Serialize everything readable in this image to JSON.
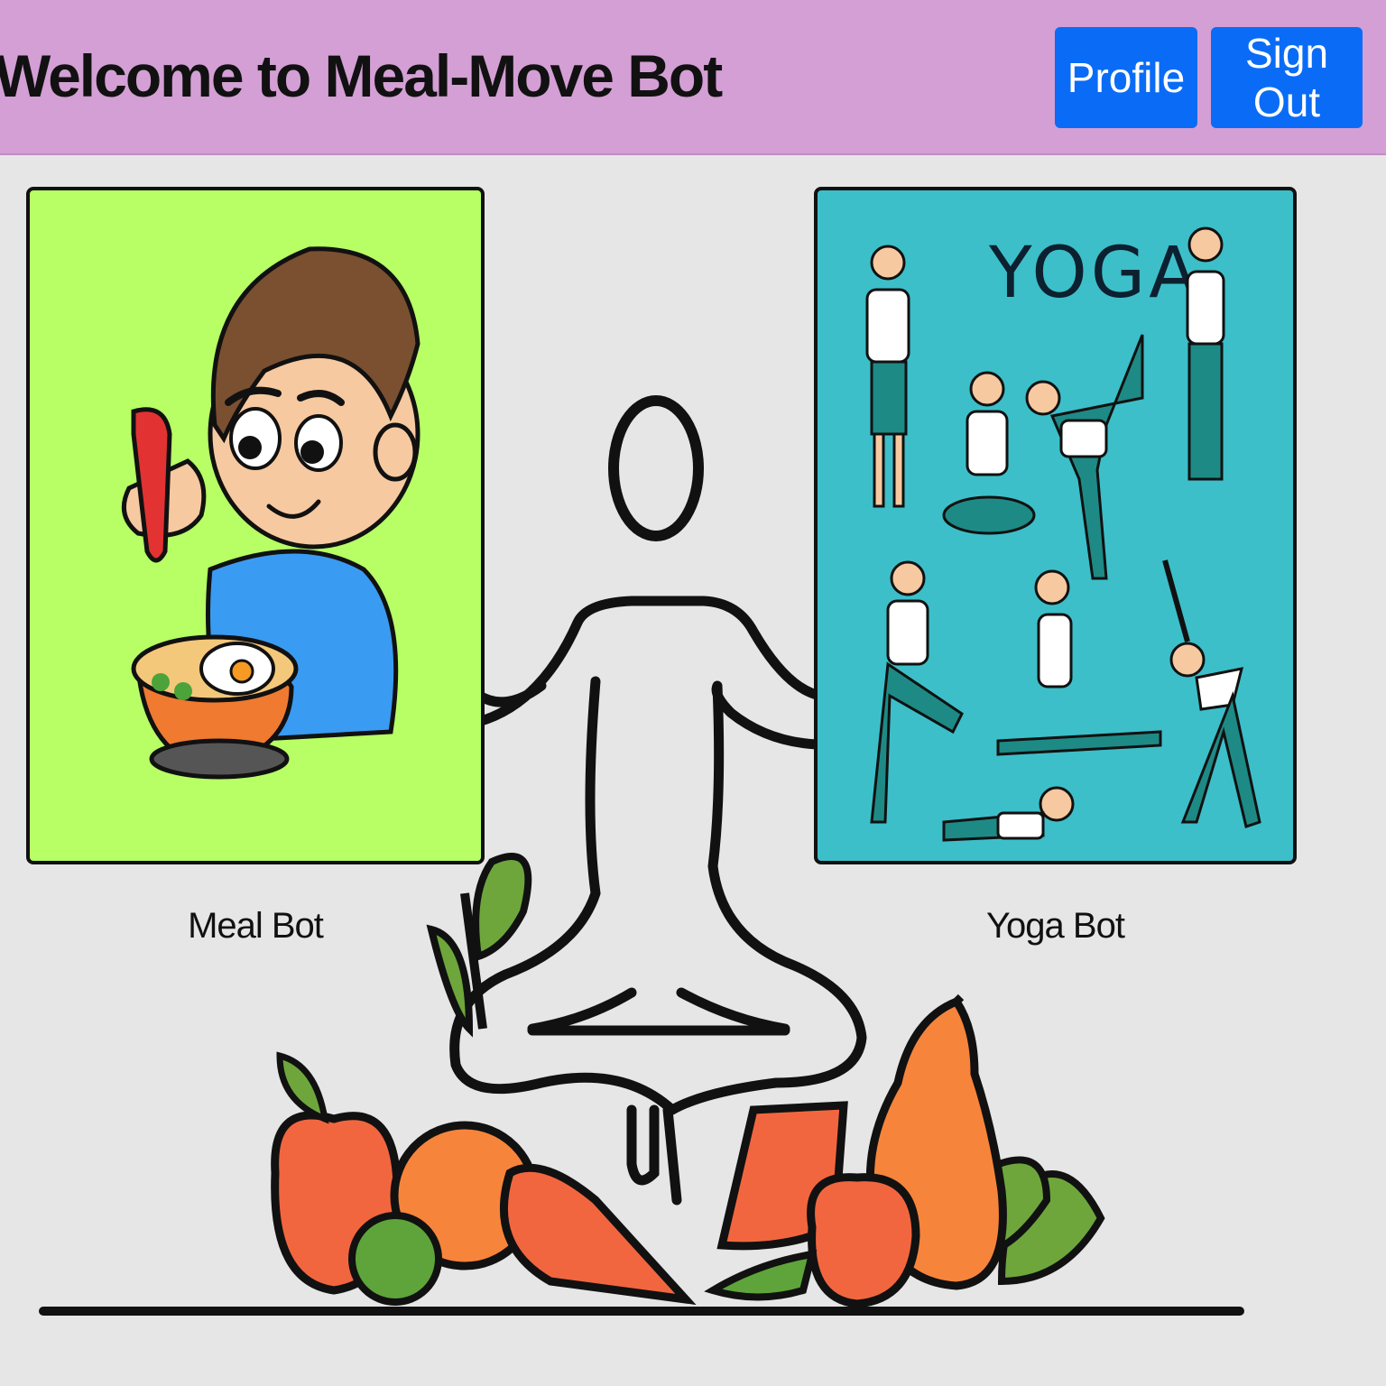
{
  "header": {
    "title": "Welcome to Meal-Move Bot",
    "buttons": {
      "profile": "Profile",
      "sign_out": "Sign Out"
    }
  },
  "cards": {
    "meal": {
      "label": "Meal Bot"
    },
    "yoga": {
      "label": "Yoga Bot",
      "image_text": "YOGA"
    }
  },
  "colors": {
    "header_bg": "#d39fd4",
    "button_bg": "#0a6cf6",
    "meal_card_bg": "#b7ff65",
    "yoga_card_bg": "#3cbfc9",
    "page_bg": "#e6e6e6"
  },
  "icons": {
    "background": "meditating-figure-with-fruits-illustration",
    "meal_card": "boy-cooking-illustration",
    "yoga_card": "yoga-poses-illustration"
  }
}
